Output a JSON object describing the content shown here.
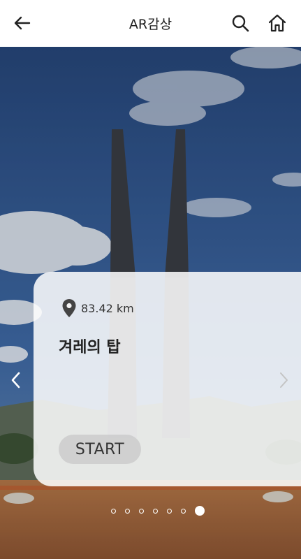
{
  "header": {
    "title": "AR감상",
    "back_icon": "arrow-left-icon",
    "search_icon": "search-icon",
    "home_icon": "home-icon"
  },
  "card": {
    "distance": "83.42 km",
    "place_name": "겨레의 탑",
    "start_label": "START",
    "location_icon": "location-pin-icon"
  },
  "carousel": {
    "total_slides": 7,
    "active_index": 6
  },
  "colors": {
    "sky": "#2d4f86",
    "card": "#f4f4f4",
    "ground": "#a9683e"
  }
}
